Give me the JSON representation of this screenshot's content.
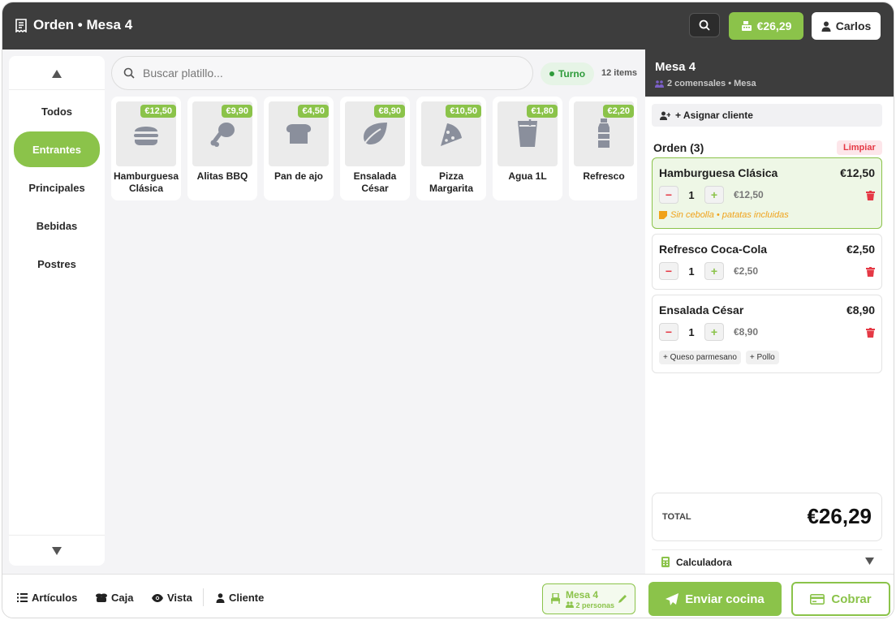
{
  "header": {
    "title": "Orden • Mesa 4",
    "total": "€26,29",
    "user": "Carlos"
  },
  "categories": {
    "items": [
      "Todos",
      "Entrantes",
      "Principales",
      "Bebidas",
      "Postres"
    ],
    "active": "Entrantes"
  },
  "search": {
    "placeholder": "Buscar platillo...",
    "shift_label": "Turno",
    "items_count": "12 items"
  },
  "products": [
    {
      "name": "Hamburguesa Clásica",
      "price": "€12,50",
      "icon": "burger-icon"
    },
    {
      "name": "Alitas BBQ",
      "price": "€9,90",
      "icon": "drumstick-icon"
    },
    {
      "name": "Pan de ajo",
      "price": "€4,50",
      "icon": "bread-icon"
    },
    {
      "name": "Ensalada César",
      "price": "€8,90",
      "icon": "leaf-icon"
    },
    {
      "name": "Pizza Margarita",
      "price": "€10,50",
      "icon": "pizza-icon"
    },
    {
      "name": "Agua 1L",
      "price": "€1,80",
      "icon": "glass-icon"
    },
    {
      "name": "Refresco",
      "price": "€2,20",
      "icon": "bottle-icon"
    }
  ],
  "order_panel": {
    "table_title": "Mesa 4",
    "table_subtitle": "2 comensales • Mesa",
    "assign_client": "+ Asignar cliente",
    "order_title": "Orden (3)",
    "clear_label": "Limpiar",
    "lines": [
      {
        "name": "Hamburguesa Clásica",
        "total": "€12,50",
        "qty": "1",
        "unit": "€12,50",
        "note": "Sin cebolla • patatas incluidas",
        "extras": []
      },
      {
        "name": "Refresco Coca-Cola",
        "total": "€2,50",
        "qty": "1",
        "unit": "€2,50",
        "note": "",
        "extras": []
      },
      {
        "name": "Ensalada César",
        "total": "€8,90",
        "qty": "1",
        "unit": "€8,90",
        "note": "",
        "extras": [
          "+ Queso parmesano",
          "+ Pollo"
        ]
      }
    ],
    "total_label": "TOTAL",
    "total_value": "€26,29",
    "calculator_label": "Calculadora"
  },
  "footer": {
    "nav": [
      "Artículos",
      "Caja",
      "Vista",
      "Cliente"
    ],
    "mesa_label": "Mesa 4",
    "mesa_sub": "2 personas",
    "send_label": "Enviar cocina",
    "pay_label": "Cobrar"
  },
  "colors": {
    "accent": "#8bc34a",
    "header": "#3d3d3d",
    "danger": "#e53945",
    "note": "#f0a21a"
  }
}
